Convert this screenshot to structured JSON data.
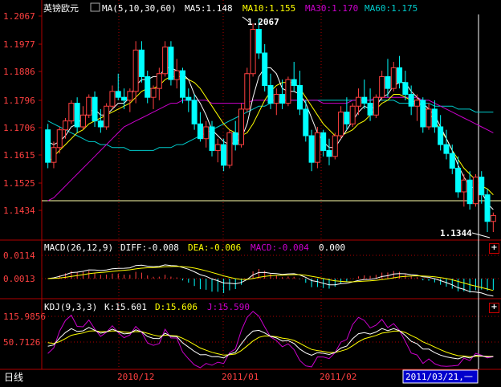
{
  "header": {
    "instrument": "英镑欧元",
    "ma_label": "MA(5,10,30,60)",
    "ma5": "MA5:1.148",
    "ma10": "MA10:1.155",
    "ma30": "MA30:1.170",
    "ma60": "MA60:1.175"
  },
  "price_axis": [
    "1.2067",
    "1.1977",
    "1.1886",
    "1.1796",
    "1.1706",
    "1.1615",
    "1.1525",
    "1.1434"
  ],
  "annotations": {
    "high": "1.2067",
    "low": "1.1344"
  },
  "macd_header": {
    "label": "MACD(26,12,9)",
    "diff": "DIFF:-0.008",
    "dea": "DEA:-0.006",
    "macd": "MACD:-0.004",
    "extra": "0.000"
  },
  "macd_axis": [
    "0.0114",
    "0.0013"
  ],
  "kdj_header": {
    "label": "KDJ(9,3,3)",
    "k": "K:15.601",
    "d": "D:15.606",
    "j": "J:15.590"
  },
  "kdj_axis": [
    "115.9856",
    "50.7126"
  ],
  "date_axis": [
    "2010/12",
    "2011/01",
    "2011/02"
  ],
  "period_label": "日线",
  "cursor_date": "2011/03/21,一",
  "colors": {
    "up": "#ff4040",
    "down": "#00ffff",
    "ma5": "#ffffff",
    "ma10": "#ffff00",
    "ma30": "#cc00cc",
    "ma60": "#00cccc",
    "grid": "#b00000"
  },
  "chart_data": {
    "type": "candlestick",
    "price_range": [
      1.134,
      1.2067
    ],
    "candles": [
      [
        1.169,
        1.171,
        1.156,
        1.158
      ],
      [
        1.158,
        1.165,
        1.156,
        1.163
      ],
      [
        1.163,
        1.17,
        1.161,
        1.169
      ],
      [
        1.169,
        1.173,
        1.166,
        1.172
      ],
      [
        1.172,
        1.179,
        1.171,
        1.178
      ],
      [
        1.178,
        1.18,
        1.168,
        1.17
      ],
      [
        1.17,
        1.177,
        1.169,
        1.174
      ],
      [
        1.174,
        1.181,
        1.173,
        1.18
      ],
      [
        1.18,
        1.182,
        1.17,
        1.172
      ],
      [
        1.172,
        1.176,
        1.168,
        1.17
      ],
      [
        1.17,
        1.178,
        1.169,
        1.177
      ],
      [
        1.177,
        1.184,
        1.176,
        1.182
      ],
      [
        1.182,
        1.188,
        1.179,
        1.18
      ],
      [
        1.18,
        1.183,
        1.176,
        1.179
      ],
      [
        1.179,
        1.183,
        1.175,
        1.182
      ],
      [
        1.182,
        1.199,
        1.178,
        1.196
      ],
      [
        1.196,
        1.199,
        1.185,
        1.187
      ],
      [
        1.187,
        1.189,
        1.178,
        1.18
      ],
      [
        1.18,
        1.184,
        1.176,
        1.183
      ],
      [
        1.183,
        1.19,
        1.179,
        1.188
      ],
      [
        1.188,
        1.199,
        1.187,
        1.197
      ],
      [
        1.197,
        1.199,
        1.184,
        1.186
      ],
      [
        1.186,
        1.193,
        1.183,
        1.189
      ],
      [
        1.189,
        1.19,
        1.178,
        1.18
      ],
      [
        1.18,
        1.183,
        1.175,
        1.179
      ],
      [
        1.179,
        1.181,
        1.169,
        1.171
      ],
      [
        1.171,
        1.175,
        1.165,
        1.166
      ],
      [
        1.166,
        1.172,
        1.163,
        1.17
      ],
      [
        1.17,
        1.172,
        1.16,
        1.162
      ],
      [
        1.162,
        1.166,
        1.158,
        1.164
      ],
      [
        1.164,
        1.166,
        1.155,
        1.157
      ],
      [
        1.157,
        1.169,
        1.156,
        1.168
      ],
      [
        1.168,
        1.172,
        1.162,
        1.164
      ],
      [
        1.164,
        1.178,
        1.163,
        1.176
      ],
      [
        1.176,
        1.19,
        1.175,
        1.188
      ],
      [
        1.188,
        1.205,
        1.187,
        1.203
      ],
      [
        1.203,
        1.2067,
        1.193,
        1.195
      ],
      [
        1.195,
        1.198,
        1.182,
        1.184
      ],
      [
        1.184,
        1.188,
        1.176,
        1.178
      ],
      [
        1.178,
        1.183,
        1.174,
        1.181
      ],
      [
        1.181,
        1.186,
        1.176,
        1.178
      ],
      [
        1.178,
        1.187,
        1.177,
        1.186
      ],
      [
        1.186,
        1.192,
        1.182,
        1.184
      ],
      [
        1.184,
        1.189,
        1.174,
        1.176
      ],
      [
        1.176,
        1.179,
        1.165,
        1.167
      ],
      [
        1.167,
        1.169,
        1.155,
        1.158
      ],
      [
        1.158,
        1.17,
        1.156,
        1.168
      ],
      [
        1.168,
        1.169,
        1.16,
        1.162
      ],
      [
        1.162,
        1.166,
        1.157,
        1.16
      ],
      [
        1.16,
        1.168,
        1.159,
        1.167
      ],
      [
        1.167,
        1.177,
        1.166,
        1.175
      ],
      [
        1.175,
        1.18,
        1.169,
        1.171
      ],
      [
        1.171,
        1.178,
        1.17,
        1.177
      ],
      [
        1.177,
        1.183,
        1.174,
        1.18
      ],
      [
        1.18,
        1.186,
        1.176,
        1.178
      ],
      [
        1.178,
        1.183,
        1.172,
        1.174
      ],
      [
        1.174,
        1.181,
        1.173,
        1.18
      ],
      [
        1.18,
        1.189,
        1.179,
        1.187
      ],
      [
        1.187,
        1.193,
        1.18,
        1.183
      ],
      [
        1.183,
        1.192,
        1.182,
        1.19
      ],
      [
        1.19,
        1.194,
        1.183,
        1.185
      ],
      [
        1.185,
        1.189,
        1.179,
        1.181
      ],
      [
        1.181,
        1.184,
        1.174,
        1.177
      ],
      [
        1.177,
        1.181,
        1.172,
        1.179
      ],
      [
        1.179,
        1.18,
        1.168,
        1.17
      ],
      [
        1.17,
        1.178,
        1.169,
        1.176
      ],
      [
        1.176,
        1.179,
        1.168,
        1.17
      ],
      [
        1.17,
        1.174,
        1.162,
        1.164
      ],
      [
        1.164,
        1.169,
        1.159,
        1.161
      ],
      [
        1.161,
        1.164,
        1.154,
        1.156
      ],
      [
        1.156,
        1.16,
        1.146,
        1.148
      ],
      [
        1.148,
        1.154,
        1.143,
        1.152
      ],
      [
        1.152,
        1.155,
        1.142,
        1.144
      ],
      [
        1.144,
        1.154,
        1.143,
        1.153
      ],
      [
        1.153,
        1.155,
        1.144,
        1.147
      ],
      [
        1.147,
        1.149,
        1.1344,
        1.138
      ],
      [
        1.138,
        1.141,
        1.1344,
        1.14
      ]
    ],
    "ma5": [
      1.165,
      1.164,
      1.165,
      1.167,
      1.17,
      1.171,
      1.173,
      1.175,
      1.176,
      1.174,
      1.174,
      1.176,
      1.178,
      1.178,
      1.18,
      1.184,
      1.186,
      1.186,
      1.187,
      1.187,
      1.19,
      1.19,
      1.189,
      1.188,
      1.186,
      1.181,
      1.178,
      1.174,
      1.169,
      1.167,
      1.165,
      1.164,
      1.165,
      1.166,
      1.171,
      1.18,
      1.187,
      1.19,
      1.19,
      1.188,
      1.183,
      1.182,
      1.182,
      1.181,
      1.178,
      1.173,
      1.168,
      1.165,
      1.163,
      1.163,
      1.166,
      1.169,
      1.172,
      1.175,
      1.177,
      1.176,
      1.177,
      1.18,
      1.181,
      1.184,
      1.185,
      1.185,
      1.182,
      1.18,
      1.178,
      1.176,
      1.174,
      1.17,
      1.166,
      1.162,
      1.157,
      1.153,
      1.15,
      1.149,
      1.148,
      1.144,
      1.142
    ],
    "ma10": [
      1.158,
      1.16,
      1.162,
      1.164,
      1.166,
      1.168,
      1.169,
      1.171,
      1.172,
      1.173,
      1.174,
      1.175,
      1.176,
      1.177,
      1.178,
      1.18,
      1.182,
      1.183,
      1.183,
      1.184,
      1.186,
      1.187,
      1.187,
      1.187,
      1.186,
      1.185,
      1.183,
      1.18,
      1.177,
      1.174,
      1.171,
      1.169,
      1.168,
      1.167,
      1.168,
      1.171,
      1.175,
      1.179,
      1.182,
      1.184,
      1.185,
      1.185,
      1.185,
      1.183,
      1.18,
      1.177,
      1.174,
      1.171,
      1.169,
      1.167,
      1.167,
      1.168,
      1.169,
      1.171,
      1.172,
      1.174,
      1.176,
      1.178,
      1.179,
      1.181,
      1.181,
      1.18,
      1.179,
      1.178,
      1.177,
      1.175,
      1.172,
      1.169,
      1.166,
      1.162,
      1.159,
      1.156,
      1.154,
      1.152,
      1.15,
      1.149,
      1.147
    ],
    "ma30": [
      1.145,
      1.146,
      1.148,
      1.15,
      1.152,
      1.154,
      1.156,
      1.158,
      1.16,
      1.162,
      1.164,
      1.166,
      1.168,
      1.17,
      1.171,
      1.172,
      1.173,
      1.174,
      1.175,
      1.176,
      1.177,
      1.178,
      1.178,
      1.179,
      1.179,
      1.179,
      1.179,
      1.179,
      1.178,
      1.178,
      1.178,
      1.178,
      1.178,
      1.178,
      1.178,
      1.179,
      1.179,
      1.179,
      1.179,
      1.179,
      1.179,
      1.179,
      1.179,
      1.179,
      1.179,
      1.179,
      1.179,
      1.178,
      1.178,
      1.178,
      1.178,
      1.178,
      1.179,
      1.179,
      1.179,
      1.179,
      1.18,
      1.18,
      1.18,
      1.18,
      1.18,
      1.18,
      1.18,
      1.18,
      1.179,
      1.179,
      1.178,
      1.177,
      1.176,
      1.175,
      1.174,
      1.173,
      1.172,
      1.171,
      1.17,
      1.169,
      1.168
    ],
    "ma60": [
      1.172,
      1.171,
      1.17,
      1.169,
      1.168,
      1.167,
      1.166,
      1.165,
      1.165,
      1.164,
      1.164,
      1.163,
      1.163,
      1.163,
      1.162,
      1.162,
      1.162,
      1.162,
      1.162,
      1.163,
      1.163,
      1.163,
      1.164,
      1.164,
      1.165,
      1.166,
      1.167,
      1.168,
      1.169,
      1.17,
      1.171,
      1.172,
      1.173,
      1.174,
      1.175,
      1.176,
      1.177,
      1.177,
      1.178,
      1.178,
      1.179,
      1.179,
      1.179,
      1.179,
      1.179,
      1.179,
      1.179,
      1.179,
      1.179,
      1.179,
      1.179,
      1.179,
      1.179,
      1.179,
      1.179,
      1.179,
      1.179,
      1.179,
      1.179,
      1.179,
      1.178,
      1.178,
      1.178,
      1.178,
      1.178,
      1.178,
      1.177,
      1.177,
      1.177,
      1.177,
      1.176,
      1.176,
      1.176,
      1.175,
      1.175,
      1.175,
      1.175
    ]
  }
}
